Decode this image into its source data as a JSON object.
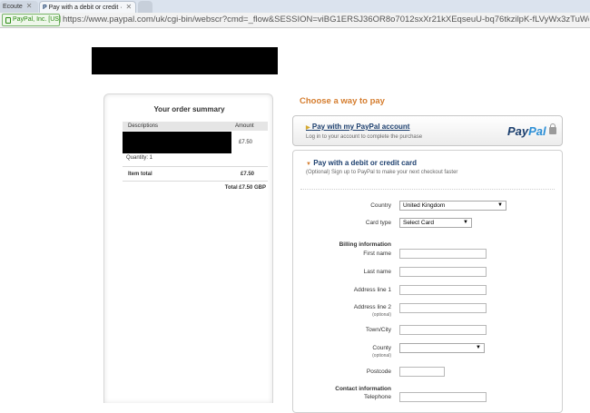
{
  "browser": {
    "tabs": [
      {
        "label": "Ecoute",
        "active": false
      },
      {
        "label": "Pay with a debit or credit ·",
        "active": true
      }
    ],
    "security_badge": "PayPal, Inc. [US]",
    "url": "https://www.paypal.com/uk/cgi-bin/webscr?cmd=_flow&SESSION=viBG1ERSJ36OR8o7012sxXr21kXEqseuU-bq76tkzilpK-fLVyWx3zTuWdC&dispatch="
  },
  "order_summary": {
    "title": "Your order summary",
    "columns": [
      "Descriptions",
      "Amount"
    ],
    "item_amount": "£7.50",
    "quantity": "Quantity: 1",
    "item_total_label": "Item total",
    "item_total_value": "£7.50",
    "grand_total": "Total £7.50 GBP"
  },
  "payment": {
    "heading": "Choose a way to pay",
    "paypal_option": {
      "title": "Pay with my PayPal account",
      "subtitle": "Log in to your account to complete the purchase",
      "logo_pay": "Pay",
      "logo_pal": "Pal"
    },
    "card_option": {
      "title": "Pay with a debit or credit card",
      "subtitle": "(Optional) Sign up to PayPal to make your next checkout faster"
    }
  },
  "form": {
    "country_label": "Country",
    "country_value": "United Kingdom",
    "card_type_label": "Card type",
    "card_type_value": "Select Card",
    "billing_heading": "Billing information",
    "first_name": "First name",
    "last_name": "Last name",
    "address1": "Address line 1",
    "address2": "Address line 2",
    "address2_note": "(optional)",
    "town": "Town/City",
    "county": "County",
    "county_note": "(optional)",
    "postcode": "Postcode",
    "contact_heading": "Contact information",
    "telephone": "Telephone"
  },
  "colors": {
    "accent_orange": "#d57d2e",
    "paypal_dark_blue": "#1c3f6e",
    "paypal_light_blue": "#2c8fd6"
  }
}
